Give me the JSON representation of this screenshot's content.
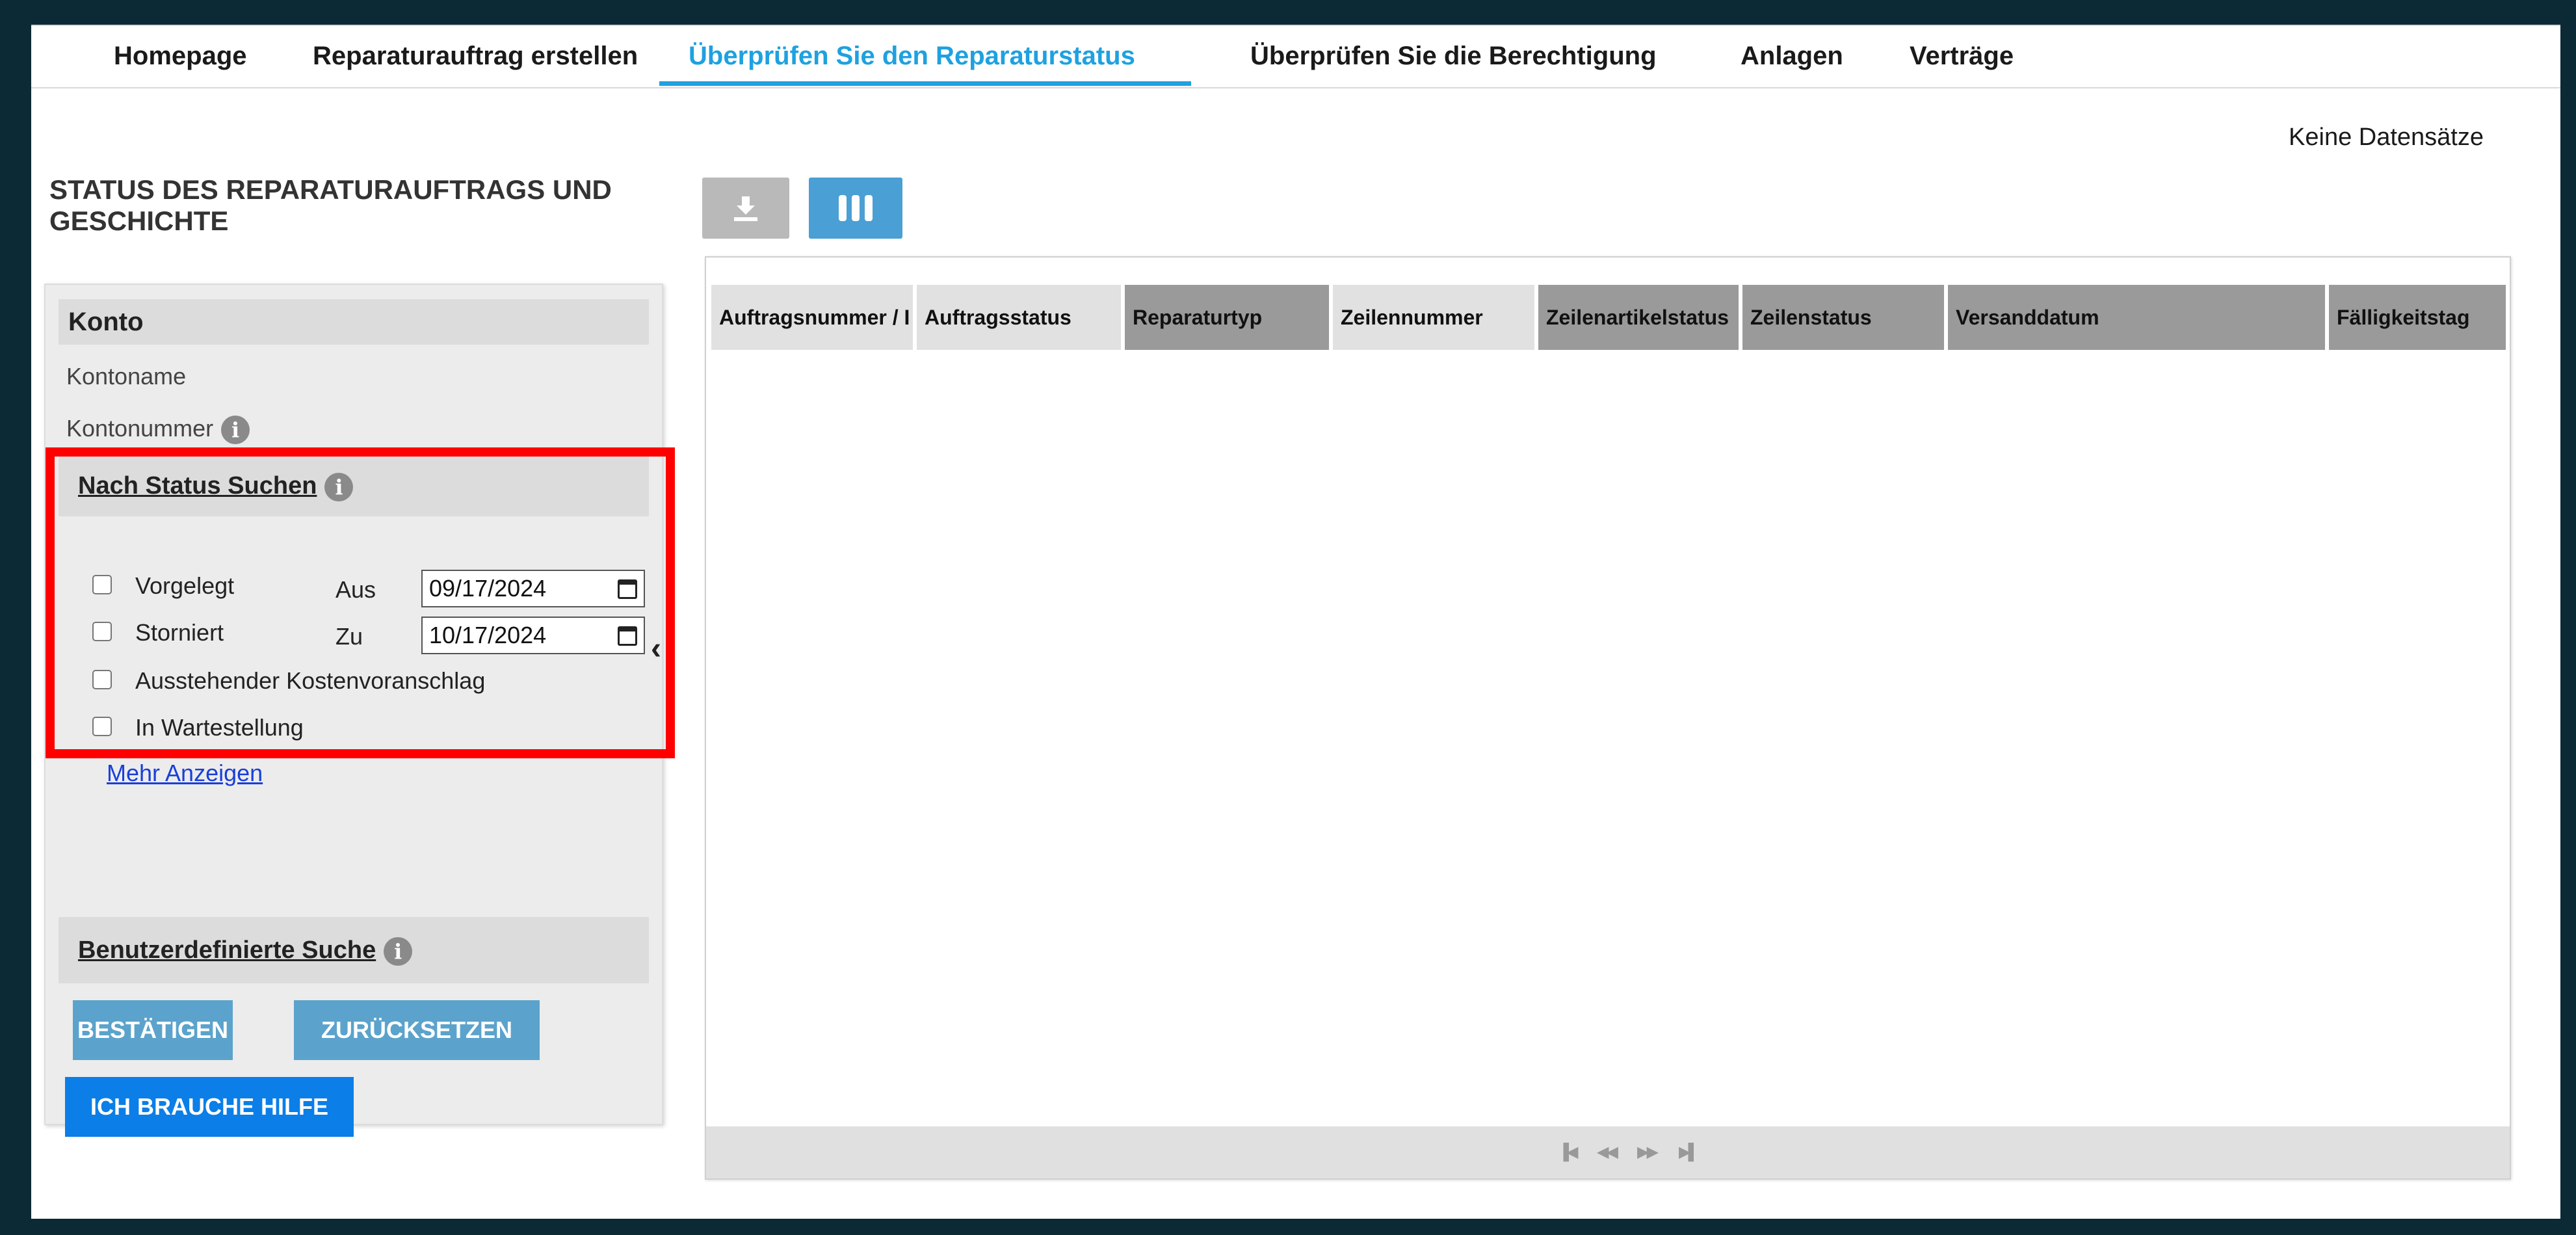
{
  "nav": {
    "tabs": [
      {
        "label": "Homepage",
        "active": false
      },
      {
        "label": "Reparaturauftrag erstellen",
        "active": false
      },
      {
        "label": "Überprüfen Sie den Reparaturstatus",
        "active": true
      },
      {
        "label": "Überprüfen Sie die Berechtigung",
        "active": false
      },
      {
        "label": "Anlagen",
        "active": false
      },
      {
        "label": "Verträge",
        "active": false
      }
    ]
  },
  "no_records": "Keine Datensätze",
  "page_title": "STATUS DES REPARATURAUFTRAGS UND GESCHICHTE",
  "toolbar": {
    "download_icon": "download-icon",
    "columns_icon": "columns-icon"
  },
  "panel": {
    "account_heading": "Konto",
    "account_name_label": "Kontoname",
    "account_number_label": "Kontonummer",
    "status_search_heading": "Nach Status Suchen",
    "statuses": [
      {
        "label": "Vorgelegt",
        "checked": false
      },
      {
        "label": "Storniert",
        "checked": false
      },
      {
        "label": "Ausstehender Kostenvoranschlag",
        "checked": false
      },
      {
        "label": "In Wartestellung",
        "checked": false
      }
    ],
    "from_label": "Aus",
    "from_date": "09/17/2024",
    "to_label": "Zu",
    "to_date": "10/17/2024",
    "more_link": "Mehr Anzeigen",
    "custom_search_heading": "Benutzerdefinierte Suche",
    "confirm_button": "BESTÄTIGEN",
    "reset_button": "ZURÜCKSETZEN",
    "help_button": "ICH BRAUCHE HILFE"
  },
  "grid": {
    "columns": [
      "Auftragsnummer / I",
      "Auftragsstatus",
      "Reparaturtyp",
      "Zeilennummer",
      "Zeilenartikelstatus",
      "Zeilenstatus",
      "Versanddatum",
      "Fälligkeitstag"
    ]
  },
  "colors": {
    "accent": "#1ea1e0",
    "highlight": "#ff0000",
    "button": "#5ba3cc",
    "help_button": "#0b7ee8"
  }
}
